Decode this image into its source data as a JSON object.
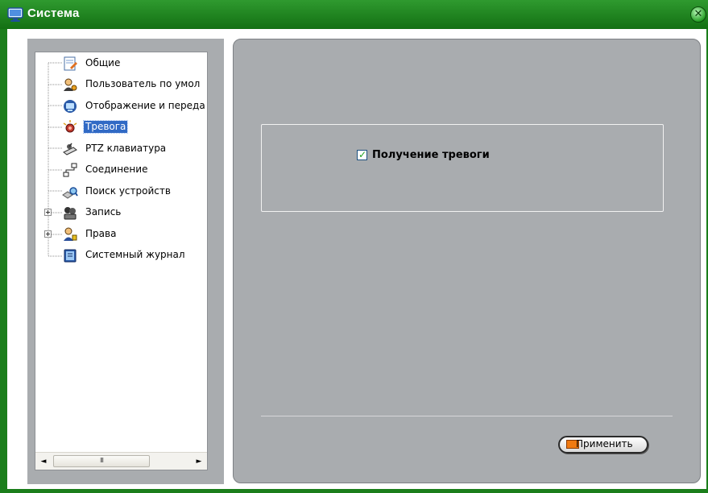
{
  "window": {
    "title": "Система",
    "close_icon": "close-icon",
    "colors": {
      "titlebar": "#1b7e1b",
      "panel": "#a9acaf",
      "selection": "#316ac5"
    }
  },
  "tree": {
    "items": [
      {
        "label": "Общие",
        "icon": "general-settings-icon",
        "expandable": false,
        "selected": false
      },
      {
        "label": "Пользователь по умол",
        "icon": "default-user-icon",
        "expandable": false,
        "selected": false
      },
      {
        "label": "Отображение и переда",
        "icon": "display-monitor-icon",
        "expandable": false,
        "selected": false
      },
      {
        "label": "Тревога",
        "icon": "alarm-icon",
        "expandable": false,
        "selected": true
      },
      {
        "label": "PTZ клавиатура",
        "icon": "ptz-keyboard-icon",
        "expandable": false,
        "selected": false
      },
      {
        "label": "Соединение",
        "icon": "network-connection-icon",
        "expandable": false,
        "selected": false
      },
      {
        "label": "Поиск устройств",
        "icon": "device-search-icon",
        "expandable": false,
        "selected": false
      },
      {
        "label": "Запись",
        "icon": "recording-icon",
        "expandable": true,
        "selected": false
      },
      {
        "label": "Права",
        "icon": "permissions-icon",
        "expandable": true,
        "selected": false
      },
      {
        "label": "Системный журнал",
        "icon": "system-log-icon",
        "expandable": false,
        "selected": false
      }
    ],
    "scrollbar": {
      "left_arrow": "◄",
      "right_arrow": "►",
      "thumb_grip": "III"
    }
  },
  "alarm_settings": {
    "receive_alarm": {
      "label": "Получение тревоги",
      "checked": true
    }
  },
  "footer": {
    "apply_label": "Применить"
  }
}
